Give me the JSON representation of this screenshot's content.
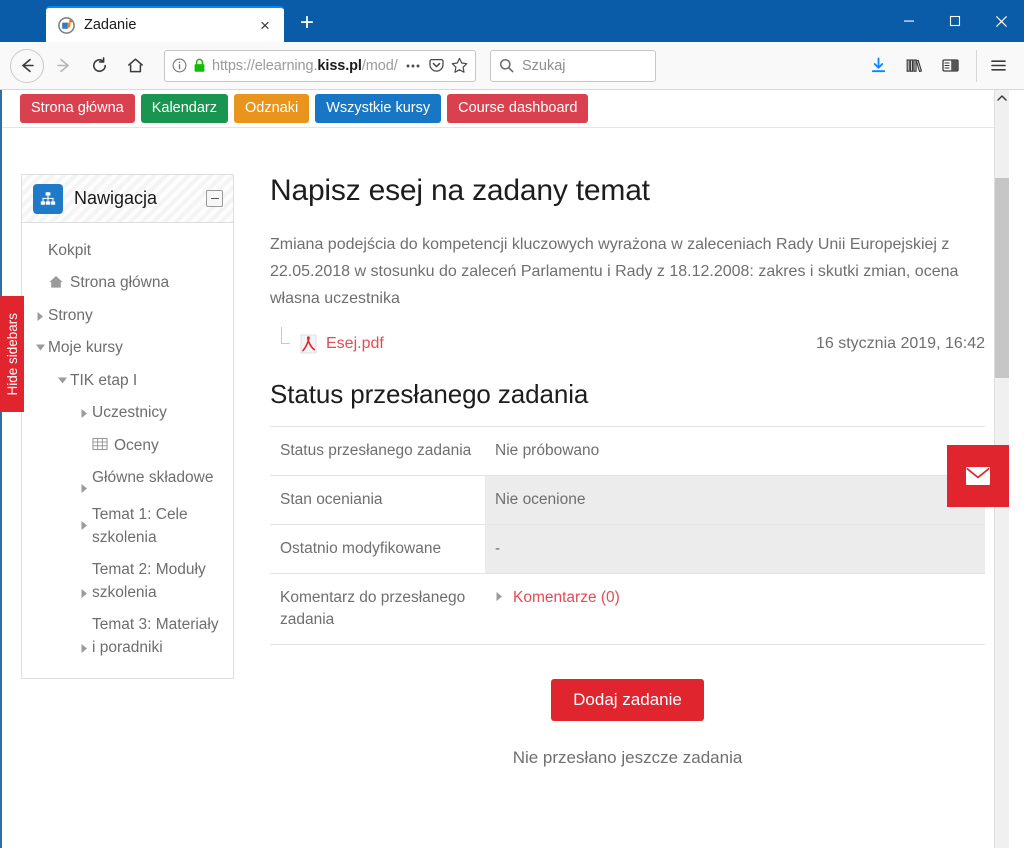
{
  "browser": {
    "tab": {
      "title": "Zadanie",
      "favicon": "moodle-logo-icon",
      "close": "×"
    },
    "new_tab": "+",
    "window_controls": {
      "minimize": "minimize-icon",
      "maximize": "maximize-icon",
      "close": "close-icon"
    },
    "nav": {
      "back": "back-arrow-icon",
      "forward": "forward-arrow-icon",
      "reload": "reload-icon",
      "home": "home-icon"
    },
    "url": {
      "info": "page-info-icon",
      "lock": "lock-icon",
      "prefix": "https://elearning.",
      "domain": "kiss.pl",
      "path": "/mod/assi",
      "full": "https://elearning.kiss.pl/mod/assi",
      "page_actions": "ellipsis-icon",
      "pocket": "pocket-icon",
      "bookmark": "star-icon"
    },
    "search": {
      "placeholder": "Szukaj",
      "icon": "search-icon"
    },
    "toolbar_icons": {
      "downloads": "download-icon",
      "library": "library-icon",
      "sidebar": "sidebar-icon",
      "menu": "hamburger-menu-icon"
    },
    "accent_blue": "#0b5ca8"
  },
  "page": {
    "topnav": [
      {
        "label": "Strona główna",
        "color": "#d8414d"
      },
      {
        "label": "Kalendarz",
        "color": "#199551"
      },
      {
        "label": "Odznaki",
        "color": "#e8941d"
      },
      {
        "label": "Wszystkie kursy",
        "color": "#1877c4"
      },
      {
        "label": "Course dashboard",
        "color": "#d8414d"
      }
    ],
    "hide_sidebars": "Hide sidebars",
    "mail_button": "envelope-icon",
    "block": {
      "title": "Nawigacja",
      "icon": "sitemap-icon",
      "collapse": "collapse-icon",
      "items": [
        {
          "label": "Kokpit",
          "indent": 0,
          "arrow": "none",
          "glyph": "none"
        },
        {
          "label": "Strona główna",
          "indent": 1,
          "arrow": "none",
          "glyph": "home-icon"
        },
        {
          "label": "Strony",
          "indent": 1,
          "arrow": "right",
          "glyph": "none"
        },
        {
          "label": "Moje kursy",
          "indent": 1,
          "arrow": "down",
          "glyph": "none"
        },
        {
          "label": "TIK etap I",
          "indent": 2,
          "arrow": "down",
          "glyph": "none"
        },
        {
          "label": "Uczestnicy",
          "indent": 3,
          "arrow": "right",
          "glyph": "none"
        },
        {
          "label": "Oceny",
          "indent": 3,
          "arrow": "none",
          "glyph": "grid-icon"
        },
        {
          "label": "Główne składowe",
          "indent": 3,
          "arrow": "right",
          "glyph": "none"
        },
        {
          "label": "Temat 1: Cele szkolenia",
          "indent": 3,
          "arrow": "right",
          "glyph": "none"
        },
        {
          "label": "Temat 2: Moduły szkolenia",
          "indent": 3,
          "arrow": "right",
          "glyph": "none"
        },
        {
          "label": "Temat 3: Materiały i poradniki",
          "indent": 3,
          "arrow": "right",
          "glyph": "none"
        }
      ]
    },
    "main": {
      "title": "Napisz esej na zadany temat",
      "intro": "Zmiana podejścia do kompetencji kluczowych wyrażona w zaleceniach Rady Unii Europejskiej z 22.05.2018 w stosunku do zaleceń Parlamentu i Rady z 18.12.2008: zakres i skutki zmian, ocena własna uczestnika",
      "attachment": {
        "name": "Esej.pdf",
        "icon": "pdf-icon",
        "date": "16 stycznia 2019, 16:42"
      },
      "section_title": "Status przesłanego zadania",
      "table": [
        {
          "label": "Status przesłanego zadania",
          "value": "Nie próbowano",
          "shaded": false
        },
        {
          "label": "Stan oceniania",
          "value": "Nie ocenione",
          "shaded": true
        },
        {
          "label": "Ostatnio modyfikowane",
          "value": "-",
          "shaded": true
        },
        {
          "label": "Komentarz do przesłanego zadania",
          "value": "Komentarze (0)",
          "shaded": false,
          "link": true,
          "arrow": "right"
        }
      ],
      "submit_button": "Dodaj zadanie",
      "no_submission": "Nie przesłano jeszcze zadania"
    }
  }
}
